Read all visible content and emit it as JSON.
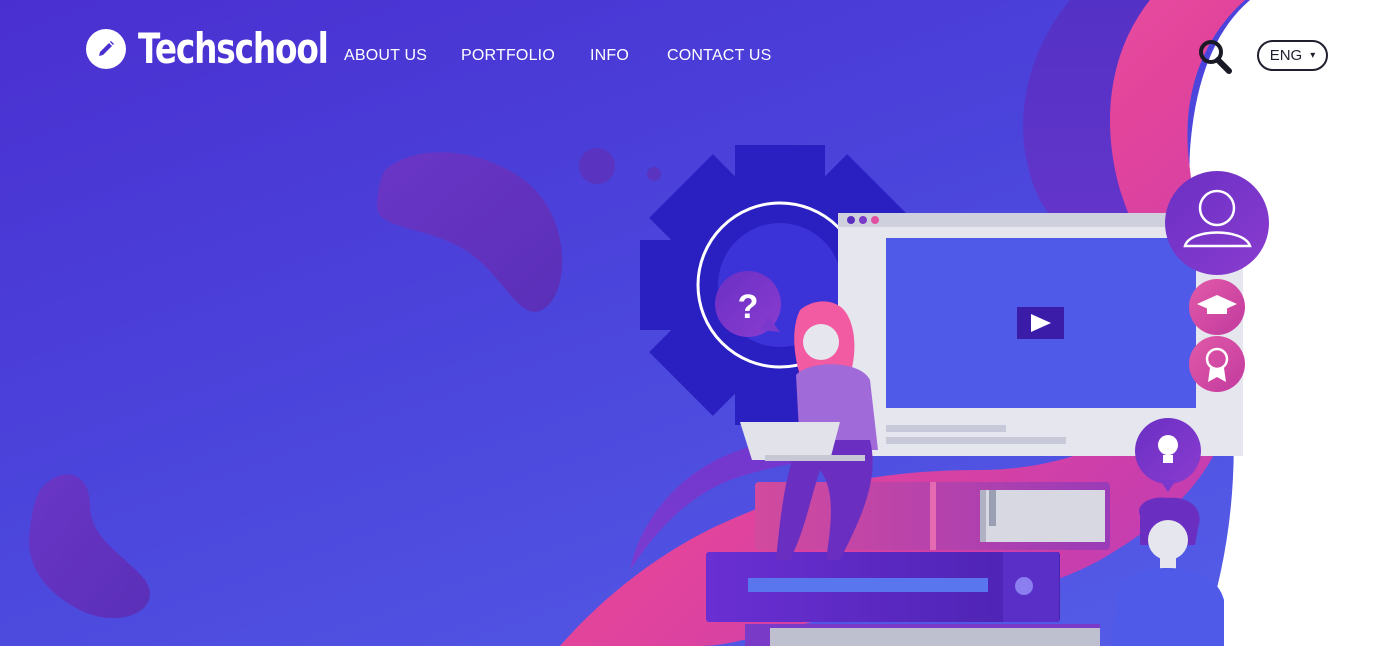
{
  "brand": {
    "name": "Techschool",
    "icon": "pencil-icon"
  },
  "nav": {
    "items": [
      {
        "label": "ABOUT US"
      },
      {
        "label": "PORTFOLIO"
      },
      {
        "label": "INFO"
      },
      {
        "label": "CONTACT US"
      }
    ]
  },
  "header_actions": {
    "search_icon": "search-icon",
    "language": {
      "selected": "ENG",
      "caret": "▾"
    }
  },
  "hero": {
    "question_mark": "?",
    "video_play_icon": "play-icon",
    "side_icons": [
      "user-icon",
      "graduation-cap-icon",
      "award-badge-icon",
      "lightbulb-icon"
    ]
  },
  "colors": {
    "background": "#4a2fd0",
    "accent_pink": "#f14fa0",
    "accent_purple": "#6a2fc0",
    "gear_blue": "#2a1fc0",
    "white": "#ffffff"
  }
}
